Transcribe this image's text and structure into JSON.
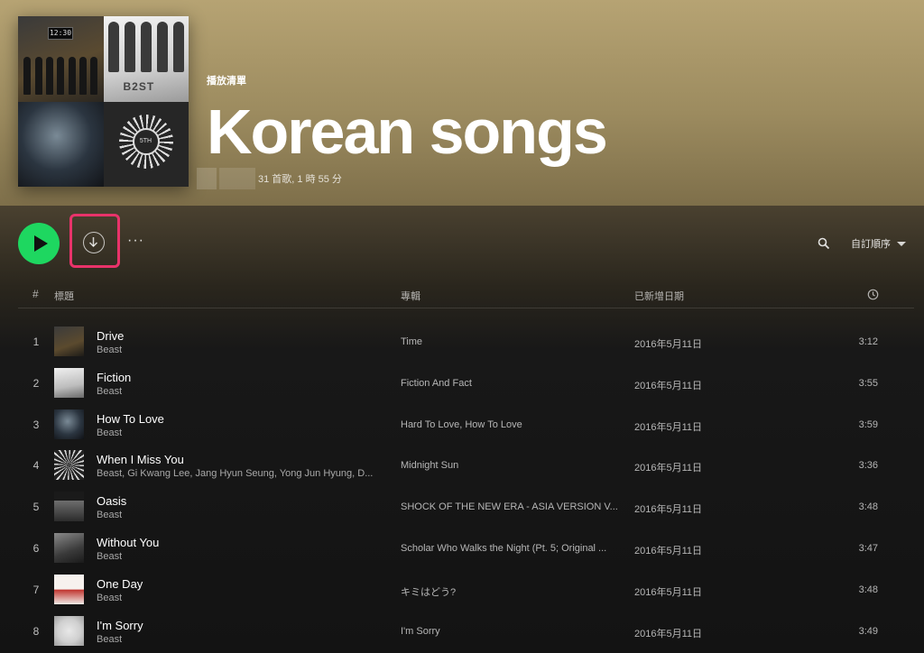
{
  "playlist": {
    "type_label": "播放清單",
    "title": "Korean songs",
    "stats": "31 首歌, 1 時 55 分"
  },
  "cover_art": {
    "clock_text": "12:30",
    "logo_text": "B2ST",
    "badge_text": "5TH"
  },
  "controls": {
    "play_icon": "play-icon",
    "download_icon": "download-icon",
    "more_label": "···",
    "search_icon": "search-icon",
    "sort_label": "自訂順序"
  },
  "colors": {
    "accent": "#1ed760",
    "highlight": "#e8336a",
    "hero": "#b6a373"
  },
  "table": {
    "headers": {
      "number": "#",
      "title": "標題",
      "album": "專輯",
      "date_added": "已新增日期",
      "duration_icon": "clock-icon"
    },
    "rows": [
      {
        "num": "1",
        "title": "Drive",
        "artist": "Beast",
        "album": "Time",
        "date": "2016年5月11日",
        "duration": "3:12"
      },
      {
        "num": "2",
        "title": "Fiction",
        "artist": "Beast",
        "album": "Fiction And Fact",
        "date": "2016年5月11日",
        "duration": "3:55"
      },
      {
        "num": "3",
        "title": "How To Love",
        "artist": "Beast",
        "album": "Hard To Love, How To Love",
        "date": "2016年5月11日",
        "duration": "3:59"
      },
      {
        "num": "4",
        "title": "When I Miss You",
        "artist": "Beast, Gi Kwang Lee, Jang Hyun Seung, Yong Jun Hyung, D...",
        "album": "Midnight Sun",
        "date": "2016年5月11日",
        "duration": "3:36"
      },
      {
        "num": "5",
        "title": "Oasis",
        "artist": "Beast",
        "album": "SHOCK OF THE NEW ERA - ASIA VERSION V...",
        "date": "2016年5月11日",
        "duration": "3:48"
      },
      {
        "num": "6",
        "title": "Without You",
        "artist": "Beast",
        "album": "Scholar Who Walks the Night (Pt. 5; Original ...",
        "date": "2016年5月11日",
        "duration": "3:47"
      },
      {
        "num": "7",
        "title": "One Day",
        "artist": "Beast",
        "album": "キミはどう?",
        "date": "2016年5月11日",
        "duration": "3:48"
      },
      {
        "num": "8",
        "title": "I'm Sorry",
        "artist": "Beast",
        "album": "I'm Sorry",
        "date": "2016年5月11日",
        "duration": "3:49"
      }
    ]
  }
}
